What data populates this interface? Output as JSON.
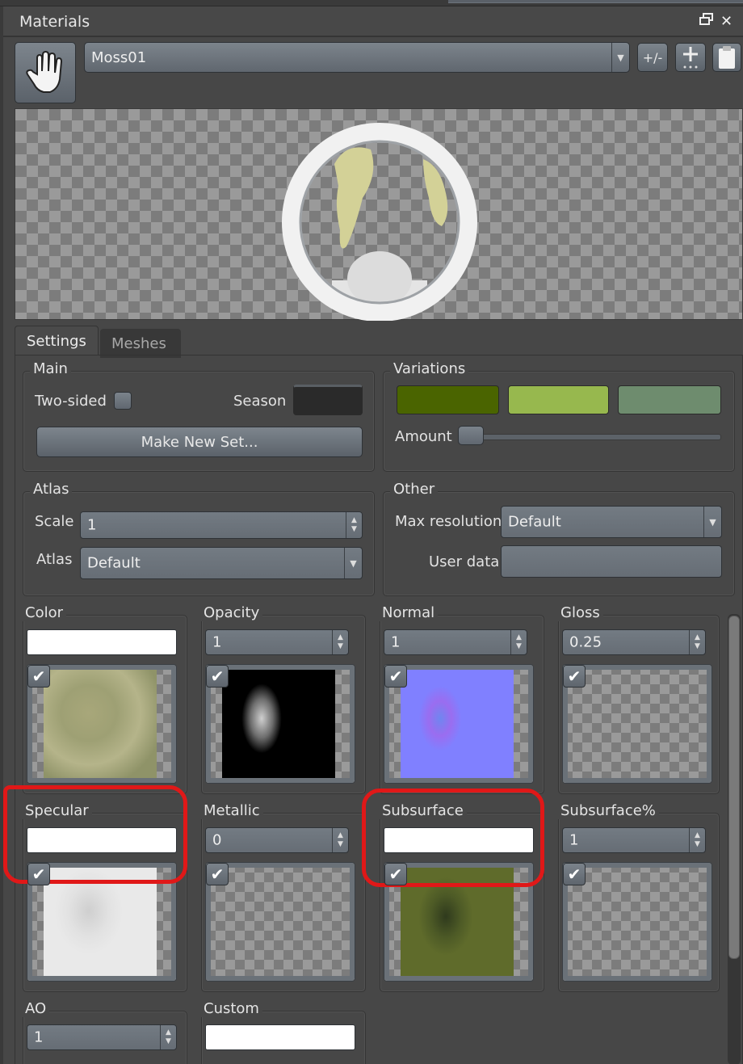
{
  "panel": {
    "title": "Materials",
    "float_icon": "float-window-icon",
    "close_icon": "close-icon"
  },
  "toolbar": {
    "hand_icon": "hand-icon",
    "material_name": "Moss01",
    "dropdown_icon": "chevron-down-icon",
    "plus_minus_label": "+/-",
    "add_icon": "add-icon",
    "paste_icon": "clipboard-icon"
  },
  "tabs": [
    {
      "label": "Settings",
      "active": true
    },
    {
      "label": "Meshes",
      "active": false
    }
  ],
  "main": {
    "title": "Main",
    "two_sided_label": "Two-sided",
    "two_sided_checked": false,
    "season_label": "Season",
    "season_color": "#2a2a2a",
    "make_new_set_label": "Make New Set..."
  },
  "variations": {
    "title": "Variations",
    "colors": [
      "#4a6400",
      "#97b84e",
      "#6e8c6e"
    ],
    "amount_label": "Amount",
    "amount_value": 0
  },
  "atlas": {
    "title": "Atlas",
    "scale_label": "Scale",
    "scale_value": "1",
    "atlas_label": "Atlas",
    "atlas_value": "Default"
  },
  "other": {
    "title": "Other",
    "max_resolution_label": "Max resolution",
    "max_resolution_value": "Default",
    "user_data_label": "User data",
    "user_data_value": ""
  },
  "channels": [
    {
      "label": "Color",
      "input": "color",
      "value": "#ffffff",
      "enabled": true,
      "texture": "moss-color"
    },
    {
      "label": "Opacity",
      "input": "number",
      "value": "1",
      "enabled": true,
      "texture": "moss-opacity"
    },
    {
      "label": "Normal",
      "input": "number",
      "value": "1",
      "enabled": true,
      "texture": "moss-normal"
    },
    {
      "label": "Gloss",
      "input": "number",
      "value": "0.25",
      "enabled": true,
      "texture": "none"
    },
    {
      "label": "Specular",
      "input": "color",
      "value": "#ffffff",
      "enabled": true,
      "texture": "moss-specular"
    },
    {
      "label": "Metallic",
      "input": "number",
      "value": "0",
      "enabled": true,
      "texture": "none"
    },
    {
      "label": "Subsurface",
      "input": "color",
      "value": "#ffffff",
      "enabled": true,
      "texture": "moss-subsurface"
    },
    {
      "label": "Subsurface%",
      "input": "number",
      "value": "1",
      "enabled": true,
      "texture": "none"
    },
    {
      "label": "AO",
      "input": "number",
      "value": "1"
    },
    {
      "label": "Custom",
      "input": "color",
      "value": "#ffffff"
    }
  ],
  "colors": {
    "panel_bg": "#474747",
    "control": "#6c737b",
    "annotation": "#e01818"
  }
}
